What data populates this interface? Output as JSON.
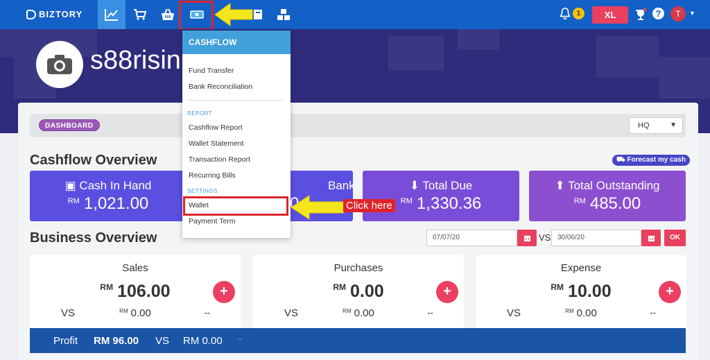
{
  "topbar": {
    "logo_text": "BIZTORY",
    "notification_count": "1",
    "plan_badge": "XL",
    "user_initial": "T"
  },
  "hero": {
    "store_name": "s88risin"
  },
  "dashboard": {
    "badge": "DASHBOARD",
    "branch_select": "HQ"
  },
  "cashflow_overview": {
    "title": "Cashflow Overview",
    "forecast_label": "Forecast my cash",
    "tiles": [
      {
        "title": "Cash In Hand",
        "currency": "RM",
        "value": "1,021.00",
        "color": "#5a4fe0"
      },
      {
        "title": "Bank",
        "currency": "",
        "value": "0",
        "color": "#5a4fe0"
      },
      {
        "title": "Total Due",
        "currency": "RM",
        "value": "1,330.36",
        "color": "#7a4dd8"
      },
      {
        "title": "Total Outstanding",
        "currency": "RM",
        "value": "485.00",
        "color": "#8b4fd0"
      }
    ]
  },
  "business_overview": {
    "title": "Business Overview",
    "date_from": "07/07/20",
    "vs_label": "VS",
    "date_to": "30/06/20",
    "ok_label": "OK",
    "cards": [
      {
        "title": "Sales",
        "currency": "RM",
        "value": "106.00",
        "vs": "VS",
        "cmp_currency": "RM",
        "cmp_value": "0.00",
        "dash": "--"
      },
      {
        "title": "Purchases",
        "currency": "RM",
        "value": "0.00",
        "vs": "VS",
        "cmp_currency": "RM",
        "cmp_value": "0.00",
        "dash": "--"
      },
      {
        "title": "Expense",
        "currency": "RM",
        "value": "10.00",
        "vs": "VS",
        "cmp_currency": "RM",
        "cmp_value": "0.00",
        "dash": "--"
      }
    ],
    "plus_label": "+",
    "profit": {
      "label": "Profit",
      "value": "RM 96.00",
      "vs": "VS",
      "cmp": "RM 0.00",
      "dash": "--"
    }
  },
  "cashflow_menu": {
    "header": "CASHFLOW",
    "items_top": [
      "Fund Transfer",
      "Bank Reconciliation"
    ],
    "report_section": "REPORT",
    "report_items": [
      "Cashflow Report",
      "Wallet Statement",
      "Transaction Report",
      "Recurring Bills"
    ],
    "settings_section": "SETTINGS",
    "settings_items": [
      "Wallet",
      "Payment Term"
    ]
  },
  "annotation": {
    "click_here": "Click here"
  },
  "colors": {
    "topbar": "#1360c7",
    "accent_pink": "#e8405e",
    "annotation_red": "#e0232a",
    "annotation_yellow": "#f5e51c"
  }
}
